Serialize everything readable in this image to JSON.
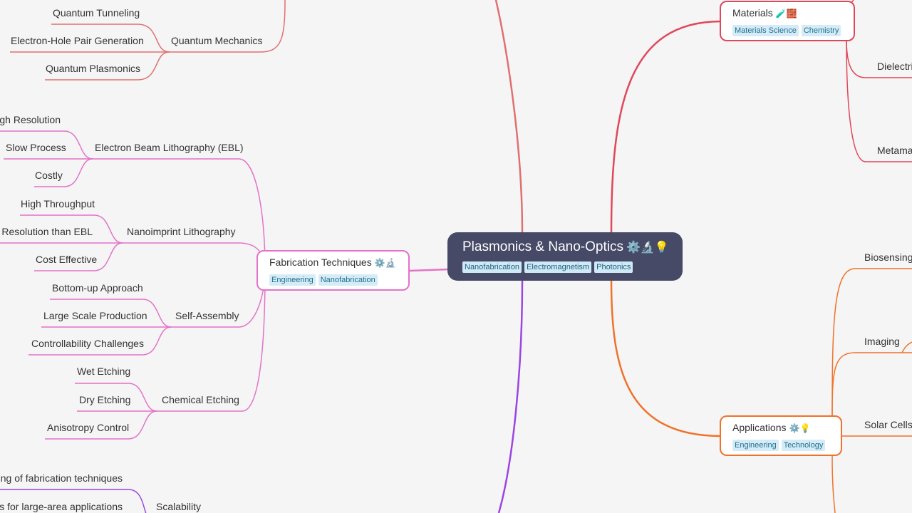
{
  "root": {
    "title": "Plasmonics & Nano-Optics",
    "emoji": "⚙️🔬💡",
    "tags": [
      "Nanofabrication",
      "Electromagnetism",
      "Photonics"
    ]
  },
  "nodes": {
    "fabrication": {
      "title": "Fabrication Techniques",
      "emoji": "⚙️🔬",
      "tags": [
        "Engineering",
        "Nanofabrication"
      ]
    },
    "materials": {
      "title": "Materials",
      "emoji": "🧪🧱",
      "tags": [
        "Materials Science",
        "Chemistry"
      ]
    },
    "applications": {
      "title": "Applications",
      "emoji": "⚙️💡",
      "tags": [
        "Engineering",
        "Technology"
      ]
    }
  },
  "quantum": {
    "label": "Quantum Mechanics",
    "children": [
      "Quantum Tunneling",
      "Electron-Hole Pair Generation",
      "Quantum Plasmonics"
    ]
  },
  "fab_groups": {
    "ebl": {
      "label": "Electron Beam Lithography (EBL)",
      "children": [
        "High Resolution",
        "Slow Process",
        "Costly"
      ]
    },
    "nil": {
      "label": "Nanoimprint Lithography",
      "children": [
        "High Throughput",
        "Lower Resolution than EBL",
        "Cost Effective"
      ]
    },
    "sa": {
      "label": "Self-Assembly",
      "children": [
        "Bottom-up Approach",
        "Large Scale Production",
        "Controllability Challenges"
      ]
    },
    "ce": {
      "label": "Chemical Etching",
      "children": [
        "Wet Etching",
        "Dry Etching",
        "Anisotropy Control"
      ]
    }
  },
  "scalability": {
    "label": "Scalability",
    "children": [
      "Scaling of fabrication techniques",
      "Needs for large-area applications"
    ]
  },
  "materials_children": [
    "Dielectrics",
    "Metamaterials"
  ],
  "applications_children": [
    "Biosensing",
    "Imaging",
    "Solar Cells"
  ],
  "colors": {
    "fabrication": "#e472c8",
    "materials": "#e0475a",
    "applications": "#f0722a",
    "quantum": "#e07070",
    "scalability": "#9b45e4",
    "root": "#464a66"
  }
}
